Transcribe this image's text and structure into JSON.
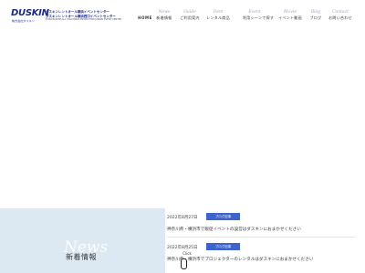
{
  "header": {
    "logo": "DUSKIN",
    "logo_sub": "株式会社ダスキン",
    "company_lines": [
      "ダスキンレントオール横浜イベントセンター",
      "ダスキンレントオール横浜西口イベントセンター"
    ],
    "company_en": "DUSKIN RENT-ALL YOKOHAMA PROMOTION JUNIOR EVENT CENTER"
  },
  "nav": {
    "home": "HOME",
    "items": [
      {
        "en": "News",
        "jp": "新着情報"
      },
      {
        "en": "Guide",
        "jp": "ご利用案内"
      },
      {
        "en": "Item",
        "jp": "レンタル商品"
      },
      {
        "en": "Event",
        "jp": "利用シーンで探す"
      },
      {
        "en": "Movie",
        "jp": "イベント動画"
      },
      {
        "en": "Blog",
        "jp": "ブログ"
      },
      {
        "en": "Contact",
        "jp": "お問い合わせ"
      }
    ]
  },
  "news": {
    "heading_en": "News",
    "heading_jp": "新着情報",
    "items": [
      {
        "date": "2022年8月27日",
        "category": "ブログ記事",
        "title": "神奈川県・横浜市で販促イベントの設営はダスキンにおまかせください"
      },
      {
        "date": "2022年8月25日",
        "category": "ブログ記事",
        "title": "神奈川県・横浜市でプロジェクターのレンタルはダスキンにおまかせください"
      }
    ]
  },
  "cursor": {
    "label": "Click"
  },
  "colors": {
    "brand": "#1a2b8c",
    "category_badge": "#3d63cf",
    "news_panel": "#dde9f2"
  }
}
